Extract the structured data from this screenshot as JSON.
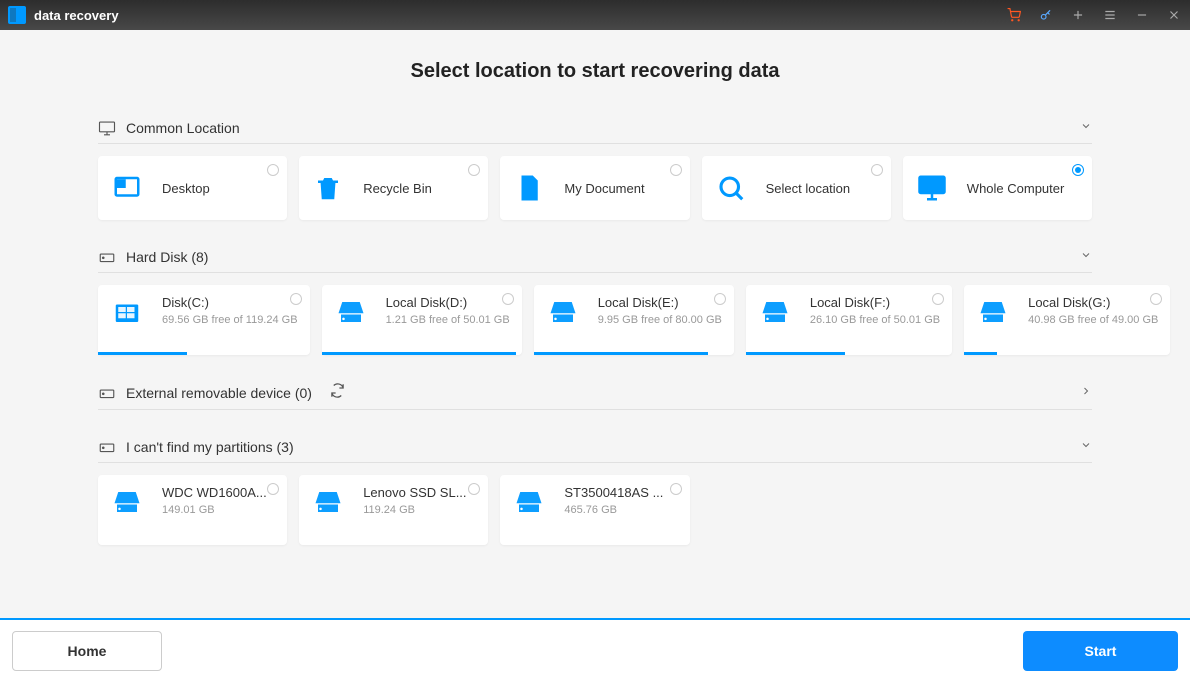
{
  "app_title": "data recovery",
  "heading": "Select location to start recovering data",
  "sections": {
    "common": {
      "title": "Common Location",
      "items": [
        {
          "label": "Desktop",
          "selected": false
        },
        {
          "label": "Recycle Bin",
          "selected": false
        },
        {
          "label": "My Document",
          "selected": false
        },
        {
          "label": "Select location",
          "selected": false
        },
        {
          "label": "Whole Computer",
          "selected": true
        }
      ]
    },
    "hard_disk": {
      "title": "Hard Disk (8)",
      "items": [
        {
          "label": "Disk(C:)",
          "sub": "69.56 GB  free of 119.24 GB",
          "usage_pct": 42
        },
        {
          "label": "Local Disk(D:)",
          "sub": "1.21 GB  free of 50.01 GB",
          "usage_pct": 97
        },
        {
          "label": "Local Disk(E:)",
          "sub": "9.95 GB  free of 80.00 GB",
          "usage_pct": 87
        },
        {
          "label": "Local Disk(F:)",
          "sub": "26.10 GB  free of 50.01 GB",
          "usage_pct": 48
        },
        {
          "label": "Local Disk(G:)",
          "sub": "40.98 GB  free of 49.00 GB",
          "usage_pct": 16
        }
      ]
    },
    "external": {
      "title": "External removable device (0)"
    },
    "partitions": {
      "title": "I can't find my partitions (3)",
      "items": [
        {
          "label": "WDC WD1600A...",
          "sub": "149.01 GB"
        },
        {
          "label": "Lenovo SSD SL...",
          "sub": "119.24 GB"
        },
        {
          "label": "ST3500418AS ...",
          "sub": "465.76 GB"
        }
      ]
    }
  },
  "footer": {
    "home": "Home",
    "start": "Start"
  }
}
